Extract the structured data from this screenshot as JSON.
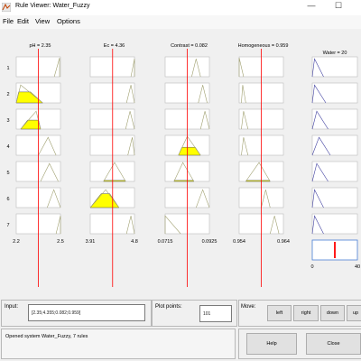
{
  "window": {
    "title": "Rule Viewer: Water_Fuzzy",
    "minimize": "—",
    "maximize": "☐"
  },
  "menu": [
    "File",
    "Edit",
    "View",
    "Options"
  ],
  "inputs": [
    {
      "header": "pH = 2.35",
      "min": "2.2",
      "max": "2.5",
      "value": 2.35,
      "range": [
        2.2,
        2.5
      ]
    },
    {
      "header": "Ec = 4.36",
      "min": "3.91",
      "max": "4.8",
      "value": 4.36,
      "range": [
        3.91,
        4.8
      ]
    },
    {
      "header": "Contrast = 0.082",
      "min": "0.0715",
      "max": "0.0925",
      "value": 0.082,
      "range": [
        0.0715,
        0.0925
      ]
    },
    {
      "header": "Homogeneous = 0.959",
      "min": "0.954",
      "max": "0.964",
      "value": 0.959,
      "range": [
        0.954,
        0.964
      ]
    }
  ],
  "output": {
    "header": "Water = 20",
    "min": "0",
    "max": "40",
    "value": 20,
    "range": [
      0,
      40
    ]
  },
  "rule_numbers": [
    "1",
    "2",
    "3",
    "4",
    "5",
    "6",
    "7"
  ],
  "input_label": "Input:",
  "input_value": "[2.35;4.355;0.082;0.959]",
  "plot_points_label": "Plot points:",
  "plot_points_value": "101",
  "move_label": "Move:",
  "buttons": {
    "left": "left",
    "right": "right",
    "down": "down",
    "up": "up",
    "help": "Help",
    "close": "Close"
  },
  "status_text": "Opened system Water_Fuzzy, 7 rules",
  "colors": {
    "fill": "#ffff00",
    "redline": "#ff0000",
    "curve_input": "#a0a070",
    "curve_output": "#4040a0"
  }
}
